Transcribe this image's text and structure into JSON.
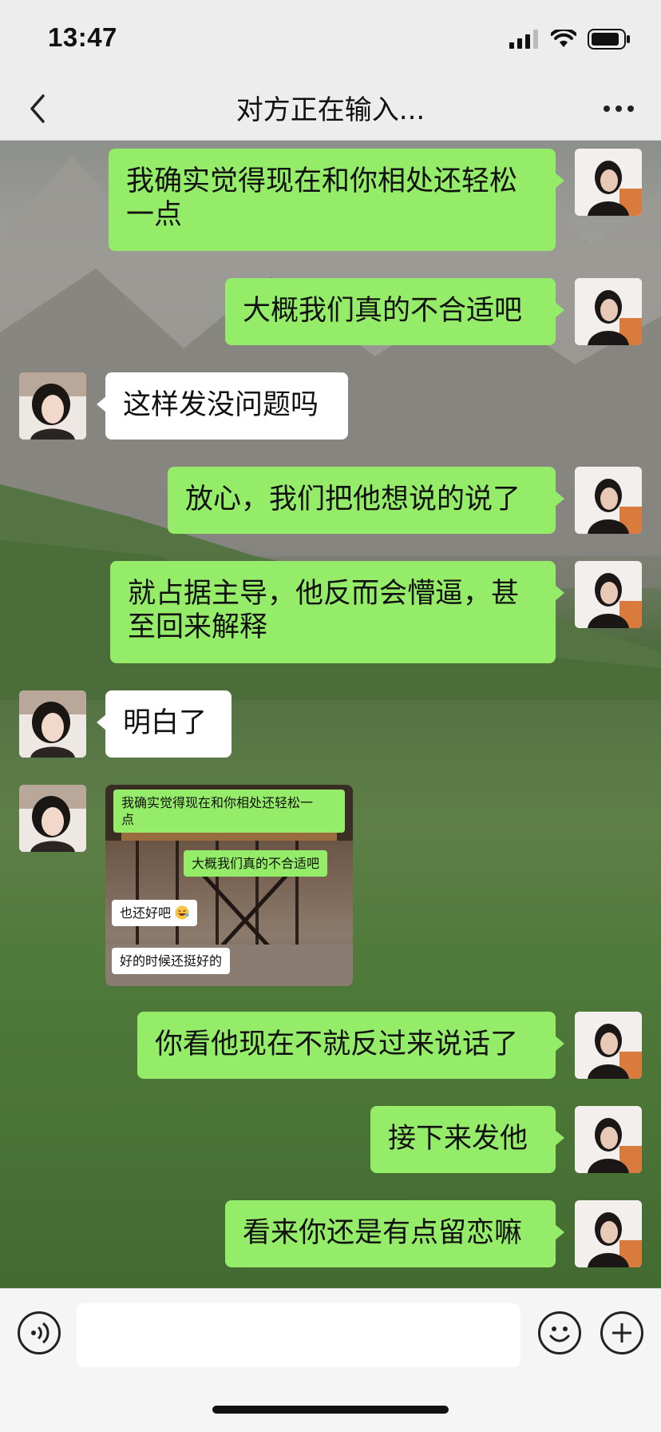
{
  "status_bar": {
    "time": "13:47"
  },
  "nav": {
    "title": "对方正在输入..."
  },
  "messages": [
    {
      "side": "right",
      "text_line1": "我确实觉得现在和你相处还轻松",
      "text_line2": "一点"
    },
    {
      "side": "right",
      "text": "大概我们真的不合适吧"
    },
    {
      "side": "left",
      "text": "这样发没问题吗"
    },
    {
      "side": "right",
      "text": "放心，我们把他想说的说了"
    },
    {
      "side": "right",
      "text_line1": "就占据主导，他反而会懵逼，甚",
      "text_line2": "至回来解释"
    },
    {
      "side": "left",
      "text": "明白了"
    },
    {
      "side": "left",
      "type": "image",
      "image": {
        "bubble1_line1": "我确实觉得现在和你相处还轻松一",
        "bubble1_line2": "点",
        "bubble2": "大概我们真的不合适吧",
        "bubble3": "也还好吧",
        "bubble3_emoji": "laughing-emoji",
        "bubble4": "好的时候还挺好的"
      }
    },
    {
      "side": "right",
      "text": "你看他现在不就反过来说话了"
    },
    {
      "side": "right",
      "text": "接下来发他"
    },
    {
      "side": "right",
      "text": "看来你还是有点留恋嘛"
    }
  ],
  "icons": {
    "back": "chevron-left-icon",
    "more": "more-dots-icon",
    "voice": "voice-icon",
    "emoji": "emoji-icon",
    "plus": "plus-icon",
    "signal": "signal-icon",
    "wifi": "wifi-icon",
    "battery": "battery-icon"
  },
  "colors": {
    "bubble_green": "#95ec69",
    "bubble_white": "#ffffff",
    "bar_bg": "#ededed"
  }
}
